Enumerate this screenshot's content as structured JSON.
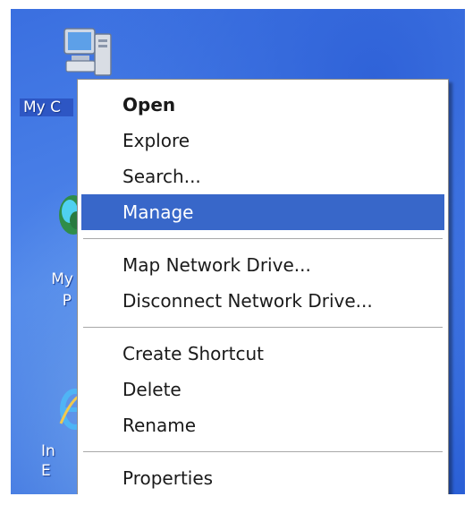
{
  "desktop": {
    "icons": [
      {
        "label": "My C"
      },
      {
        "label": "My",
        "label_line2": "P"
      },
      {
        "label": "In",
        "label_line2": "E"
      }
    ]
  },
  "context_menu": {
    "items": [
      {
        "label": "Open",
        "bold": true
      },
      {
        "label": "Explore"
      },
      {
        "label": "Search..."
      },
      {
        "label": "Manage",
        "highlighted": true
      },
      {
        "label": "Map Network Drive..."
      },
      {
        "label": "Disconnect Network Drive..."
      },
      {
        "label": "Create Shortcut"
      },
      {
        "label": "Delete"
      },
      {
        "label": "Rename"
      },
      {
        "label": "Properties"
      }
    ]
  },
  "colors": {
    "desktop_blue": "#3a6fe0",
    "highlight": "#3867c9",
    "menu_bg": "#ffffff"
  }
}
